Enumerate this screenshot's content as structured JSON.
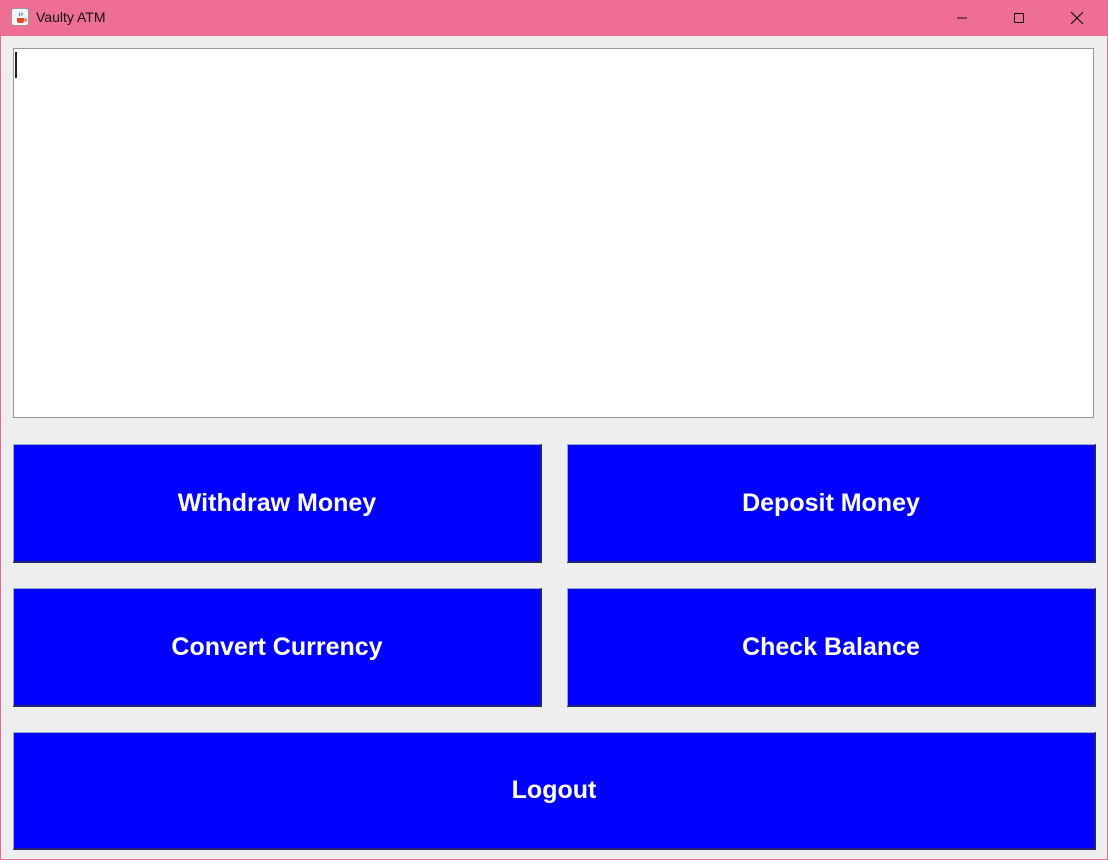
{
  "window": {
    "title": "Vaulty ATM",
    "icon": "java-cup-icon",
    "titlebar_color": "#ee6f93",
    "controls": [
      "minimize-icon",
      "maximize-icon",
      "close-icon"
    ]
  },
  "output_area": {
    "value": ""
  },
  "buttons": {
    "withdraw": "Withdraw Money",
    "deposit": "Deposit Money",
    "convert": "Convert Currency",
    "balance": "Check Balance",
    "logout": "Logout"
  },
  "colors": {
    "button_bg": "#0000ff",
    "button_text": "#ffffff",
    "window_bg": "#eeeeee"
  }
}
